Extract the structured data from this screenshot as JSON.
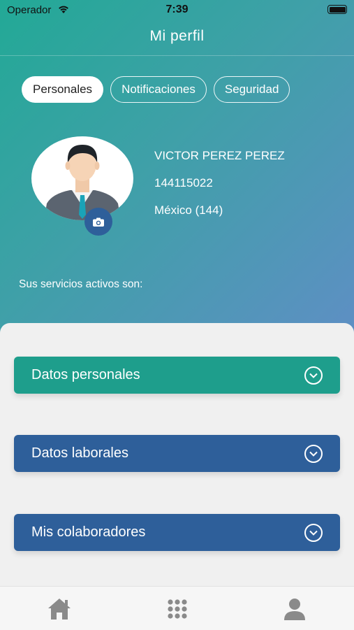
{
  "status_bar": {
    "carrier": "Operador",
    "time": "7:39"
  },
  "header": {
    "title": "Mi perfil"
  },
  "tabs": [
    {
      "label": "Personales",
      "active": true
    },
    {
      "label": "Notificaciones",
      "active": false
    },
    {
      "label": "Seguridad",
      "active": false
    }
  ],
  "profile": {
    "name": "VICTOR PEREZ PEREZ",
    "id": "144115022",
    "country": "México (144)"
  },
  "services_label": "Sus servicios activos son:",
  "sections": [
    {
      "label": "Datos personales",
      "color": "#1e9e8c"
    },
    {
      "label": "Datos laborales",
      "color": "#2e5f9a"
    },
    {
      "label": "Mis colaboradores",
      "color": "#2e5f9a"
    }
  ],
  "bottom_nav": {
    "items": [
      "home-icon",
      "apps-grid-icon",
      "profile-icon"
    ],
    "icon_color": "#8a8a8a"
  },
  "colors": {
    "gradient_start": "#22a996",
    "gradient_end": "#5e8fc4",
    "accent_blue": "#2e5f9a"
  }
}
